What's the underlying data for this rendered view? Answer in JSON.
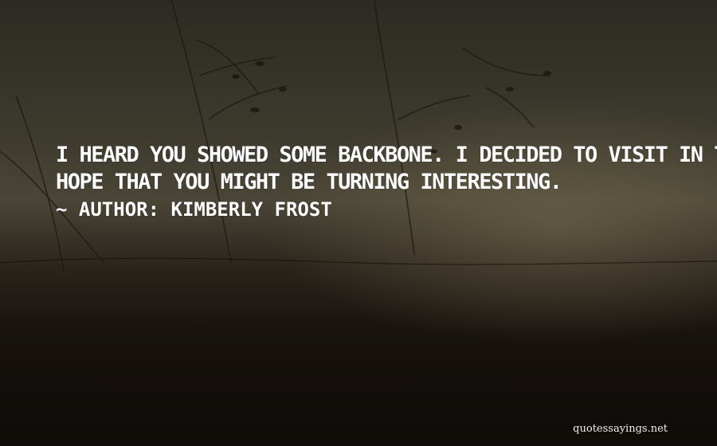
{
  "quote": {
    "line1": "I HEARD YOU SHOWED SOME BACKBONE. I DECIDED TO VISIT IN THE VAIN",
    "line2": "HOPE THAT YOU MIGHT BE TURNING INTERESTING.",
    "author_line": "~ AUTHOR: KIMBERLY FROST"
  },
  "watermark": "quotessayings.net",
  "colors": {
    "text": "#ffffff",
    "sky_top": "#2c2a22",
    "horizon": "#4a4536",
    "ground": "#0f0b08"
  }
}
